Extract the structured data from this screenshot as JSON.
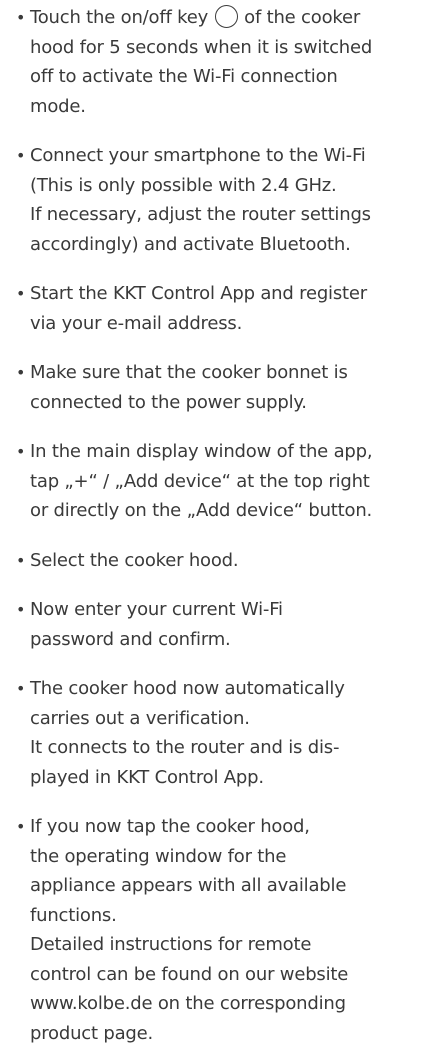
{
  "steps": [
    {
      "lines": [
        "of the cooker",
        "hood for 5 seconds when it is switched",
        "off to activate the Wi-Fi connection",
        "mode."
      ],
      "lead": "Touch the on/off key",
      "icon": "power-key-icon"
    },
    {
      "lines": [
        "Connect your smartphone to the Wi-Fi",
        "(This is only possible with 2.4 GHz.",
        "If necessary, adjust the router settings",
        "accordingly) and activate Bluetooth."
      ]
    },
    {
      "lines": [
        "Start the KKT Control App and register",
        "via your e-mail address."
      ]
    },
    {
      "lines": [
        "Make sure that the cooker bonnet is",
        "connected to the power supply."
      ]
    },
    {
      "lines": [
        "In the main display window of the app,",
        "tap „+“ / „Add device“ at the top right",
        "or directly on the „Add device“ button."
      ]
    },
    {
      "lines": [
        "Select the cooker hood."
      ]
    },
    {
      "lines": [
        "Now enter your current Wi-Fi",
        "password and confirm."
      ]
    },
    {
      "lines": [
        "The cooker hood now automatically",
        "carries out a verification.",
        "It connects to the router and is dis-",
        "played in KKT Control App."
      ]
    },
    {
      "lines": [
        "If you now tap the cooker hood,",
        "the operating window for the",
        "appliance appears with all available",
        "functions.",
        "Detailed instructions for remote",
        "control can be found on our website",
        "www.kolbe.de on the corresponding",
        "product page."
      ]
    }
  ]
}
